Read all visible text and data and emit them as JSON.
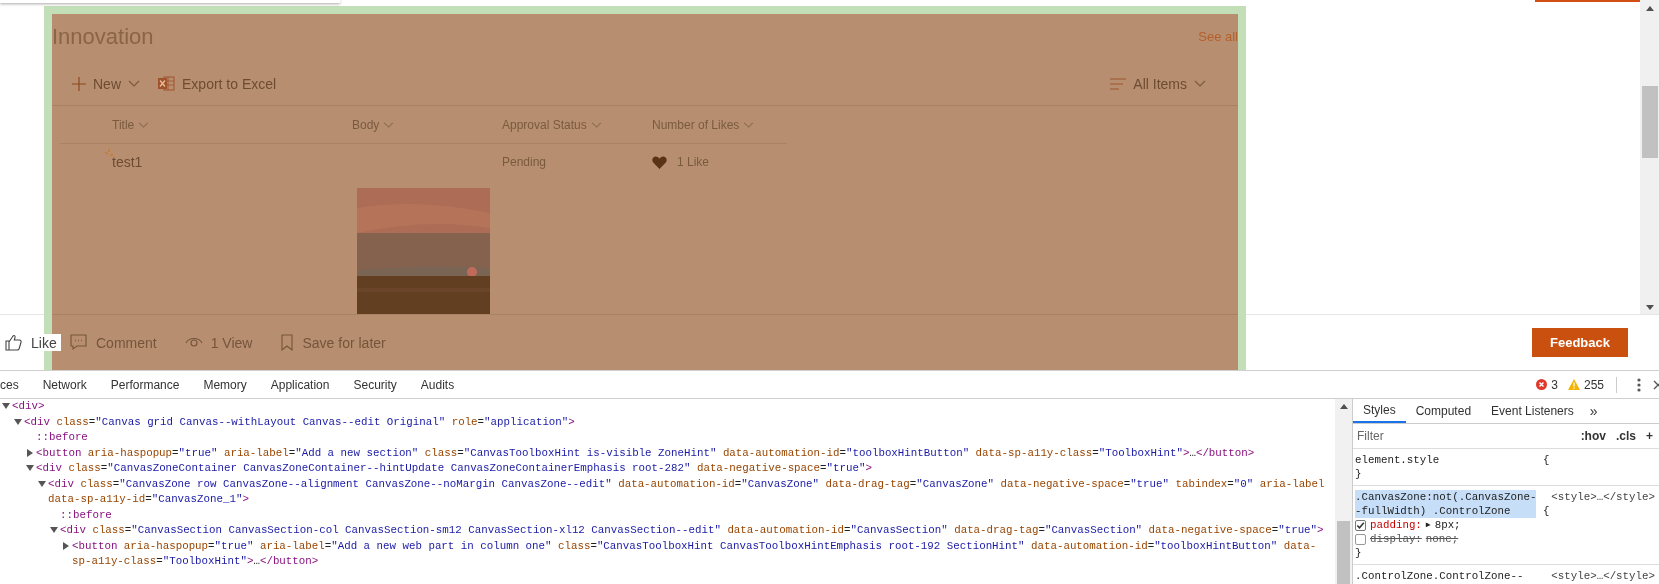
{
  "webpart": {
    "title": "Innovation",
    "see_all": "See all",
    "toolbar": {
      "new": "New",
      "export": "Export to Excel",
      "view": "All Items"
    },
    "columns": [
      "Title",
      "Body",
      "Approval Status",
      "Number of Likes"
    ],
    "rows": [
      {
        "title": "test1",
        "new": true,
        "status": "Pending",
        "likes": "1 Like",
        "liked": true
      }
    ]
  },
  "social_bar": [
    {
      "kind": "like",
      "label": "Like"
    },
    {
      "kind": "comment",
      "label": "Comment"
    },
    {
      "kind": "view",
      "label": "1 View"
    },
    {
      "kind": "save",
      "label": "Save for later"
    }
  ],
  "feedback": "Feedback",
  "devtools": {
    "tabs": [
      {
        "label": "ces",
        "selected": false
      },
      {
        "label": "Network",
        "selected": false
      },
      {
        "label": "Performance",
        "selected": false
      },
      {
        "label": "Memory",
        "selected": false
      },
      {
        "label": "Application",
        "selected": false
      },
      {
        "label": "Security",
        "selected": false
      },
      {
        "label": "Audits",
        "selected": false
      }
    ],
    "errors": "3",
    "warnings": "255",
    "dom_tree": [
      {
        "kind": "element",
        "expanded": true,
        "tokens": [
          {
            "kind": "tag",
            "text": "<div>"
          }
        ],
        "children": [
          {
            "kind": "element",
            "expanded": true,
            "tokens": [
              {
                "kind": "tag",
                "text": "<div"
              },
              {
                "kind": "attr",
                "text": " class"
              },
              {
                "kind": "punct",
                "text": "="
              },
              {
                "kind": "value",
                "text": "\"Canvas grid Canvas--withLayout Canvas--edit Original\""
              },
              {
                "kind": "attr",
                "text": " role"
              },
              {
                "kind": "punct",
                "text": "="
              },
              {
                "kind": "value",
                "text": "\"application\""
              },
              {
                "kind": "tag",
                "text": ">"
              }
            ],
            "children": [
              {
                "kind": "pseudo",
                "tokens": [
                  {
                    "kind": "tag",
                    "text": "::before"
                  }
                ]
              },
              {
                "kind": "element",
                "expanded": false,
                "tokens": [
                  {
                    "kind": "tag",
                    "text": "<button"
                  },
                  {
                    "kind": "attr",
                    "text": " aria-haspopup"
                  },
                  {
                    "kind": "punct",
                    "text": "="
                  },
                  {
                    "kind": "value",
                    "text": "\"true\""
                  },
                  {
                    "kind": "attr",
                    "text": " aria-label"
                  },
                  {
                    "kind": "punct",
                    "text": "="
                  },
                  {
                    "kind": "value",
                    "text": "\"Add a new section\""
                  },
                  {
                    "kind": "attr",
                    "text": " class"
                  },
                  {
                    "kind": "punct",
                    "text": "="
                  },
                  {
                    "kind": "value",
                    "text": "\"CanvasToolboxHint is-visible ZoneHint\""
                  },
                  {
                    "kind": "attr",
                    "text": " data-automation-id"
                  },
                  {
                    "kind": "punct",
                    "text": "="
                  },
                  {
                    "kind": "value",
                    "text": "\"toolboxHintButton\""
                  },
                  {
                    "kind": "attr",
                    "text": " data-sp-a11y-class"
                  },
                  {
                    "kind": "punct",
                    "text": "="
                  },
                  {
                    "kind": "value",
                    "text": "\"ToolboxHint\""
                  },
                  {
                    "kind": "tag",
                    "text": ">"
                  },
                  {
                    "kind": "punct",
                    "text": "…"
                  },
                  {
                    "kind": "tag",
                    "text": "</button>"
                  }
                ]
              },
              {
                "kind": "element",
                "expanded": true,
                "tokens": [
                  {
                    "kind": "tag",
                    "text": "<div"
                  },
                  {
                    "kind": "attr",
                    "text": " class"
                  },
                  {
                    "kind": "punct",
                    "text": "="
                  },
                  {
                    "kind": "value",
                    "text": "\"CanvasZoneContainer CanvasZoneContainer--hintUpdate CanvasZoneContainerEmphasis root-282\""
                  },
                  {
                    "kind": "attr",
                    "text": " data-negative-space"
                  },
                  {
                    "kind": "punct",
                    "text": "="
                  },
                  {
                    "kind": "value",
                    "text": "\"true\""
                  },
                  {
                    "kind": "tag",
                    "text": ">"
                  }
                ],
                "children": [
                  {
                    "kind": "element",
                    "expanded": true,
                    "tokens": [
                      {
                        "kind": "tag",
                        "text": "<div"
                      },
                      {
                        "kind": "attr",
                        "text": " class"
                      },
                      {
                        "kind": "punct",
                        "text": "="
                      },
                      {
                        "kind": "value",
                        "text": "\"CanvasZone row CanvasZone--alignment CanvasZone--noMargin CanvasZone--edit\""
                      },
                      {
                        "kind": "attr",
                        "text": " data-automation-id"
                      },
                      {
                        "kind": "punct",
                        "text": "="
                      },
                      {
                        "kind": "value",
                        "text": "\"CanvasZone\""
                      },
                      {
                        "kind": "attr",
                        "text": " data-drag-tag"
                      },
                      {
                        "kind": "punct",
                        "text": "="
                      },
                      {
                        "kind": "value",
                        "text": "\"CanvasZone\""
                      },
                      {
                        "kind": "attr",
                        "text": " data-negative-space"
                      },
                      {
                        "kind": "punct",
                        "text": "="
                      },
                      {
                        "kind": "value",
                        "text": "\"true\""
                      },
                      {
                        "kind": "attr",
                        "text": " tabindex"
                      },
                      {
                        "kind": "punct",
                        "text": "="
                      },
                      {
                        "kind": "value",
                        "text": "\"0\""
                      },
                      {
                        "kind": "attr",
                        "text": " aria-label"
                      },
                      {
                        "kind": "attr",
                        "text": " data-sp-a11y-id"
                      },
                      {
                        "kind": "punct",
                        "text": "="
                      },
                      {
                        "kind": "value",
                        "text": "\"CanvasZone_1\""
                      },
                      {
                        "kind": "tag",
                        "text": ">"
                      }
                    ],
                    "children": [
                      {
                        "kind": "pseudo",
                        "tokens": [
                          {
                            "kind": "tag",
                            "text": "::before"
                          }
                        ]
                      },
                      {
                        "kind": "element",
                        "expanded": true,
                        "tokens": [
                          {
                            "kind": "tag",
                            "text": "<div"
                          },
                          {
                            "kind": "attr",
                            "text": " class"
                          },
                          {
                            "kind": "punct",
                            "text": "="
                          },
                          {
                            "kind": "value",
                            "text": "\"CanvasSection CanvasSection-col CanvasSection-sm12 CanvasSection-xl12 CanvasSection--edit\""
                          },
                          {
                            "kind": "attr",
                            "text": " data-automation-id"
                          },
                          {
                            "kind": "punct",
                            "text": "="
                          },
                          {
                            "kind": "value",
                            "text": "\"CanvasSection\""
                          },
                          {
                            "kind": "attr",
                            "text": " data-drag-tag"
                          },
                          {
                            "kind": "punct",
                            "text": "="
                          },
                          {
                            "kind": "value",
                            "text": "\"CanvasSection\""
                          },
                          {
                            "kind": "attr",
                            "text": " data-negative-space"
                          },
                          {
                            "kind": "punct",
                            "text": "="
                          },
                          {
                            "kind": "value",
                            "text": "\"true\""
                          },
                          {
                            "kind": "tag",
                            "text": ">"
                          }
                        ],
                        "children": [
                          {
                            "kind": "element",
                            "expanded": false,
                            "tokens": [
                              {
                                "kind": "tag",
                                "text": "<button"
                              },
                              {
                                "kind": "attr",
                                "text": " aria-haspopup"
                              },
                              {
                                "kind": "punct",
                                "text": "="
                              },
                              {
                                "kind": "value",
                                "text": "\"true\""
                              },
                              {
                                "kind": "attr",
                                "text": " aria-label"
                              },
                              {
                                "kind": "punct",
                                "text": "="
                              },
                              {
                                "kind": "value",
                                "text": "\"Add a new web part in column one\""
                              },
                              {
                                "kind": "attr",
                                "text": " class"
                              },
                              {
                                "kind": "punct",
                                "text": "="
                              },
                              {
                                "kind": "value",
                                "text": "\"CanvasToolboxHint CanvasToolboxHintEmphasis root-192 SectionHint\""
                              },
                              {
                                "kind": "attr",
                                "text": " data-automation-id"
                              },
                              {
                                "kind": "punct",
                                "text": "="
                              },
                              {
                                "kind": "value",
                                "text": "\"toolboxHintButton\""
                              },
                              {
                                "kind": "attr",
                                "text": " data-sp-a11y-class"
                              },
                              {
                                "kind": "punct",
                                "text": "="
                              },
                              {
                                "kind": "value",
                                "text": "\"ToolboxHint\""
                              },
                              {
                                "kind": "tag",
                                "text": ">"
                              },
                              {
                                "kind": "punct",
                                "text": "…"
                              },
                              {
                                "kind": "tag",
                                "text": "</button>"
                              }
                            ]
                          }
                        ]
                      }
                    ]
                  }
                ]
              }
            ]
          }
        ]
      }
    ],
    "styles_pane": {
      "tabs": [
        {
          "label": "Styles",
          "selected": true
        },
        {
          "label": "Computed",
          "selected": false
        },
        {
          "label": "Event Listeners",
          "selected": false
        }
      ],
      "more": "»",
      "filter": {
        "placeholder": "Filter"
      },
      "buttons": [
        ":hov",
        ".cls",
        "+"
      ],
      "rules": [
        {
          "selector": "element.style",
          "highlighted": false,
          "open_brace": "{",
          "close_brace": "}"
        },
        {
          "selector": ".CanvasZone:not(.CanvasZone--fullWidth) .ControlZone",
          "highlighted": true,
          "source": "<style>…</style>",
          "open_brace": "{",
          "close_brace": "}",
          "declarations": [
            {
              "property": "padding:",
              "expander": "▶",
              "value": "8px;",
              "enabled": true
            },
            {
              "property": "display:",
              "value": "none;",
              "enabled": false
            }
          ]
        },
        {
          "selector": ".ControlZone.ControlZone--",
          "highlighted": false,
          "source": "<style>…</style>"
        }
      ]
    }
  }
}
